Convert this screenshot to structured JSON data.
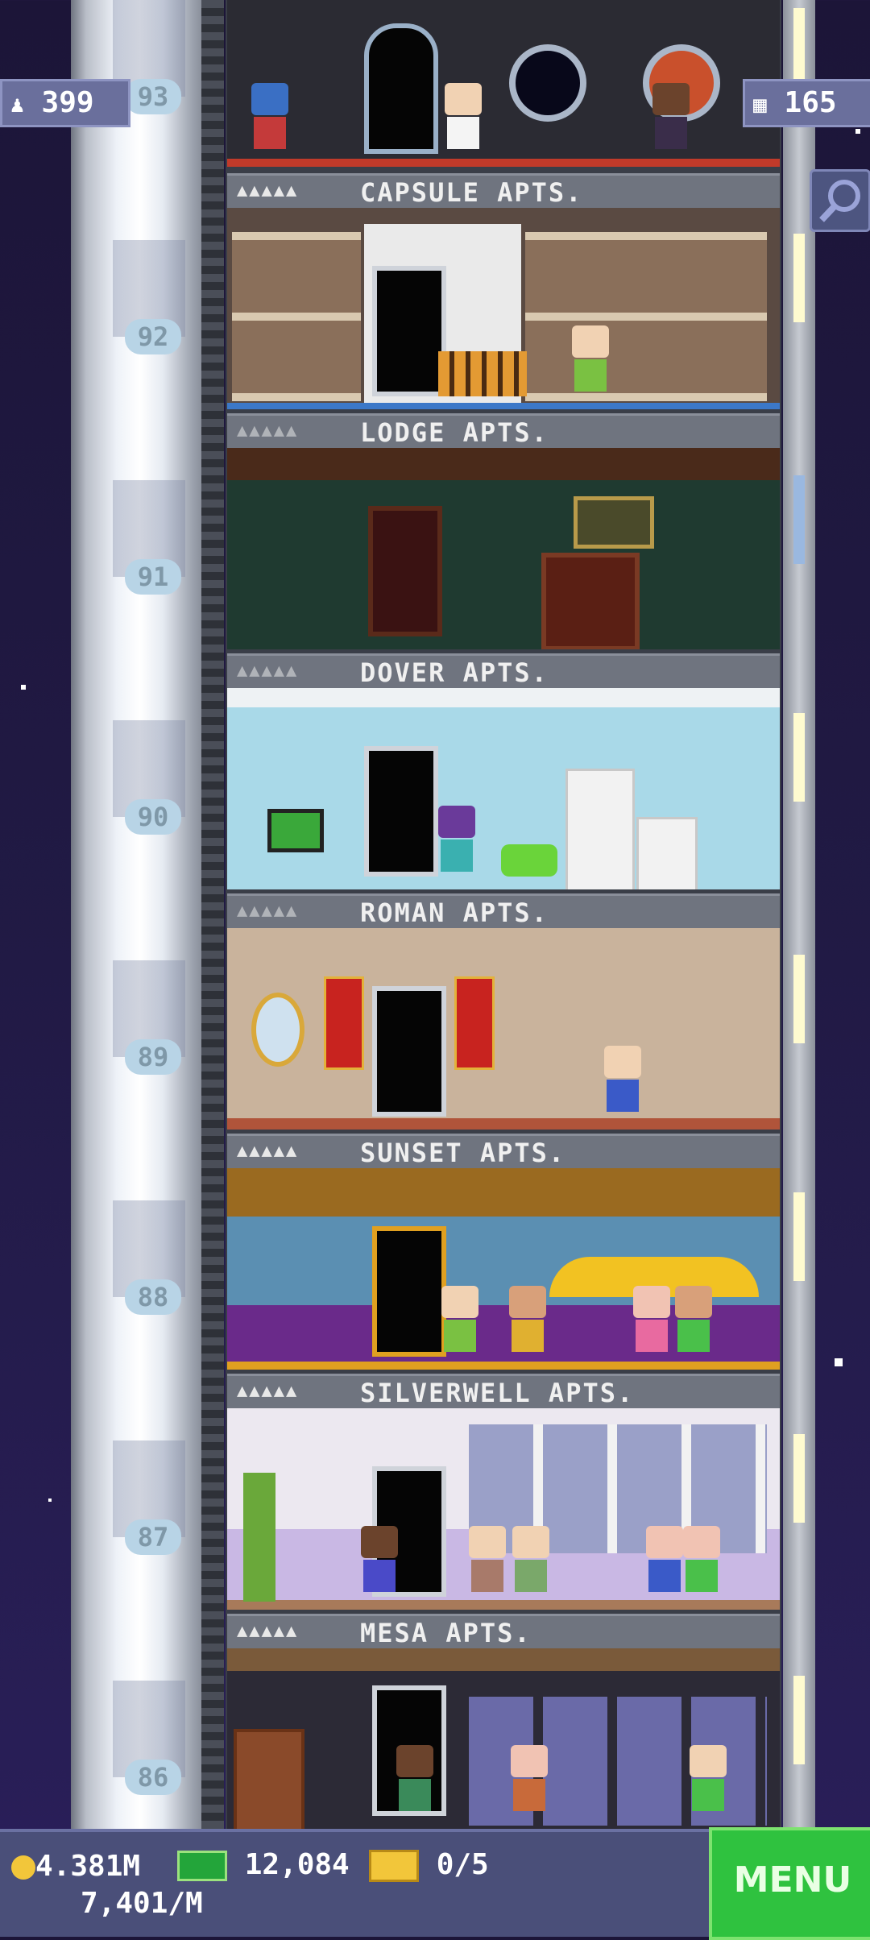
{
  "hud": {
    "population": "399",
    "floors": "165"
  },
  "shaft": {
    "floor_numbers": [
      "93",
      "92",
      "91",
      "90",
      "89",
      "88",
      "87",
      "86"
    ]
  },
  "floors": [
    {
      "name": "CAPSULE APTS.",
      "stars": "▲▲▲▲▲"
    },
    {
      "name": "LODGE APTS.",
      "stars": "▲▲▲▲▲"
    },
    {
      "name": "DOVER APTS.",
      "stars": "▲▲▲▲▲"
    },
    {
      "name": "ROMAN APTS.",
      "stars": "▲▲▲▲▲"
    },
    {
      "name": "SUNSET APTS.",
      "stars": "▲▲▲▲▲"
    },
    {
      "name": "SILVERWELL APTS.",
      "stars": "▲▲▲▲▲"
    },
    {
      "name": "MESA APTS.",
      "stars": "▲▲▲▲▲"
    }
  ],
  "bottom": {
    "coins": "4.381M",
    "bux": "12,084",
    "tickets": "0/5",
    "income": "7,401/M",
    "menu": "MENU"
  },
  "colors": {
    "menu_green": "#2fc23f",
    "hud_purple": "#6a6f9c",
    "coin_gold": "#f2c63a"
  }
}
